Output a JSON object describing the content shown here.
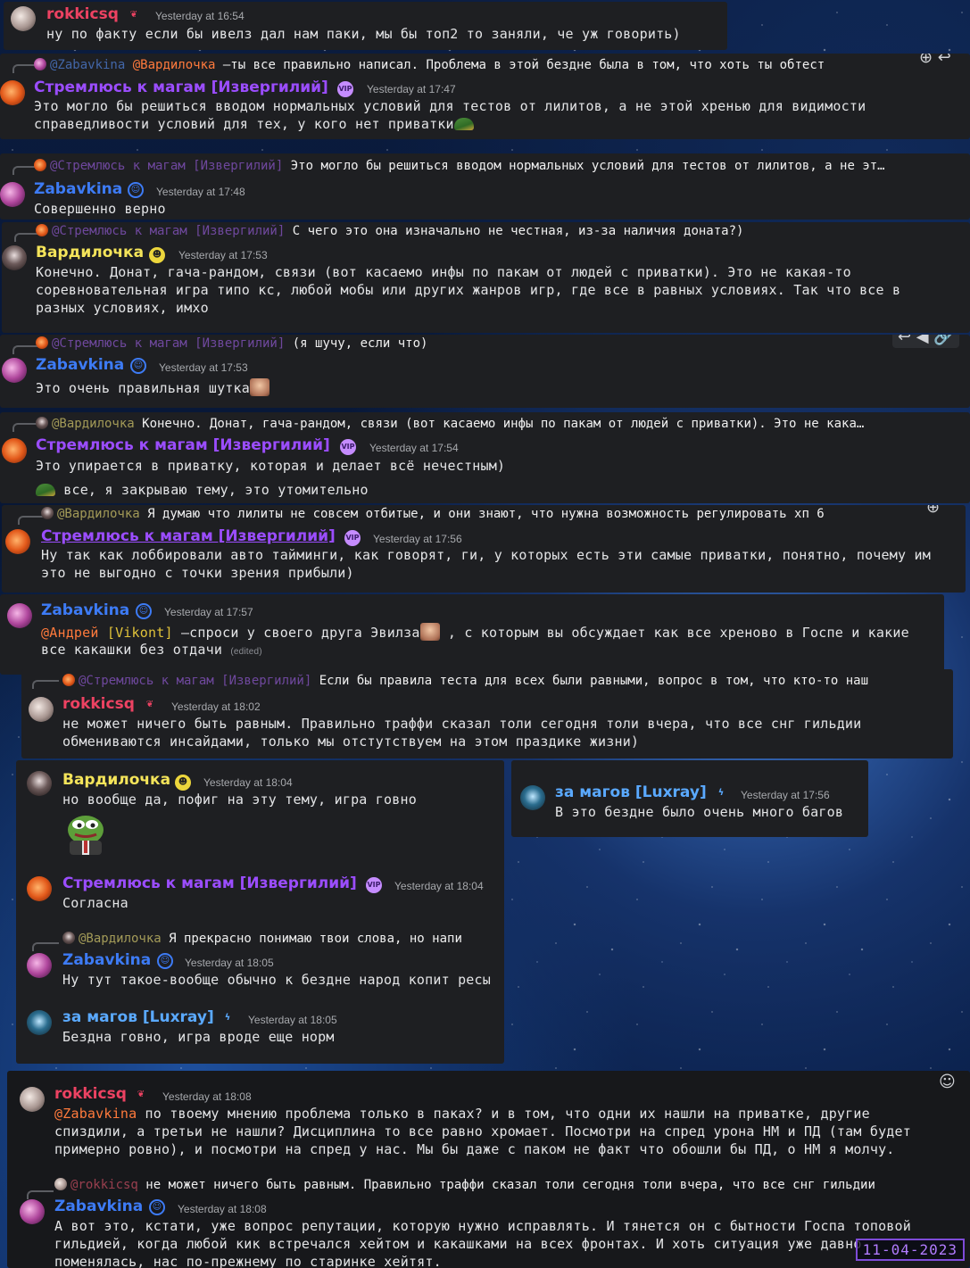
{
  "users": {
    "rokki": "rokkicsq",
    "strem": "Стремлюсь к магам [Извергилий]",
    "zaba": "Zabavkina",
    "vard": "Вардилочка",
    "lux": "за магов [Luxray]"
  },
  "badges": {
    "vip": "VIP",
    "rokki": "❦",
    "zaba": "☺",
    "vard": "☻",
    "lux": "ϟ"
  },
  "mentions": {
    "vard": "@Вардилочка",
    "zaba": "@Zabavkina",
    "strem": "@Стремлюсь к магам [Извергилий]",
    "rokki": "@rokkicsq",
    "andrey": "@Андрей",
    "vikont": "[Vikont]"
  },
  "messages": {
    "m1": {
      "time": "Yesterday at 16:54",
      "text": "ну по факту если бы ивелз дал нам паки, мы бы топ2 то заняли, че уж говорить)"
    },
    "m2": {
      "reply_text": " —ты все правильно написал. Проблема в этой бездне была в том, что хоть ты обтест",
      "time": "Yesterday at 17:47",
      "text": "Это могло бы решиться вводом нормальных условий для тестов от лилитов, а не этой хренью для видимости\nсправедливости условий для тех, у кого нет приватки"
    },
    "m3": {
      "reply_text": " Это могло бы решиться вводом нормальных условий для тестов от лилитов, а не эт…",
      "time": "Yesterday at 17:48",
      "text": "Совершенно верно"
    },
    "m4": {
      "reply_text": " С чего это она изначально не честная, из-за наличия доната?)",
      "time": "Yesterday at 17:53",
      "text": "Конечно. Донат, гача-рандом, связи (вот касаемо инфы по пакам от людей с приватки). Это не какая-то\nсоревновательная игра типо кс, любой мобы или других жанров игр, где все в равных условиях. Так что все в\nразных условиях, имхо"
    },
    "m5": {
      "reply_text": " (я шучу, если что)",
      "time": "Yesterday at 17:53",
      "text": "Это очень правильная шутка"
    },
    "m6": {
      "reply_text": " Конечно. Донат, гача-рандом, связи (вот касаемо инфы по пакам от людей с приватки). Это не кака…",
      "time": "Yesterday at 17:54",
      "text": "Это упирается в приватку, которая и делает всё нечестным)",
      "text2": " все, я закрываю тему, это утомительно"
    },
    "m7": {
      "reply_text": " Я думаю что лилиты не совсем отбитые, и они знают, что нужна возможность регулировать хп 6",
      "time": "Yesterday at 17:56",
      "text": "Ну так как лоббировали авто тайминги, как говорят, ги, у которых есть эти самые приватки, понятно, почему им\nэто не выгодно с точки зрения прибыли)"
    },
    "m8": {
      "time": "Yesterday at 17:57",
      "text_a": " —спроси у своего друга Эвилза",
      "text_b": " , с которым вы обсуждает как все хреново в Госпе и какие",
      "text_c": "все какашки без отдачи ",
      "edited": "(edited)"
    },
    "m9": {
      "reply_text": " Если бы правила теста для всех были равными, вопрос в том, что кто-то наш",
      "time": "Yesterday at 18:02",
      "text": "не может ничего быть равным. Правильно траффи сказал толи сегодня толи вчера, что все снг гильдии\nобмениваются инсайдами, только мы отстутствуем на этом праздике жизни)"
    },
    "m10": {
      "time": "Yesterday at 18:04",
      "text": "но вообще да, пофиг на эту тему, игра говно"
    },
    "m11": {
      "time": "Yesterday at 18:04",
      "text": "Согласна"
    },
    "m12": {
      "reply_text": " Я прекрасно понимаю твои слова, но напи",
      "time": "Yesterday at 18:05",
      "text": "Ну тут такое-вообще обычно к бездне народ копит ресы"
    },
    "m13": {
      "time": "Yesterday at 18:05",
      "text": "Бездна говно, игра вроде еще норм"
    },
    "m14": {
      "time": "Yesterday at 17:56",
      "text": "В это бездне было очень много багов"
    },
    "m15": {
      "time": "Yesterday at 18:08",
      "text_a": " по твоему мнению проблема только в паках? и в том, что одни их нашли на приватке, другие",
      "text_b": "спиздили, а третьи не нашли? Дисциплина то все равно хромает. Посмотри на спред урона НМ и ПД (там будет\nпримерно ровно), и посмотри на спред у нас. Мы бы даже с паком не факт что обошли бы ПД, о НМ я молчу."
    },
    "m16": {
      "reply_text": " не может ничего быть равным. Правильно траффи сказал толи сегодня толи вчера, что все снг гильдии",
      "time": "Yesterday at 18:08",
      "text": "А вот это, кстати, уже вопрос репутации, которую нужно исправлять. И тянется он с бытности Госпа топовой\nгильдией, когда любой кик встречался хейтом и какашками на всех фронтах. И хоть ситуация уже давно\nпоменялась, нас по-прежнему по старинке хейтят."
    }
  },
  "hover_icons": "↩  ◀  🔗",
  "date_stamp": "11-04-2023"
}
